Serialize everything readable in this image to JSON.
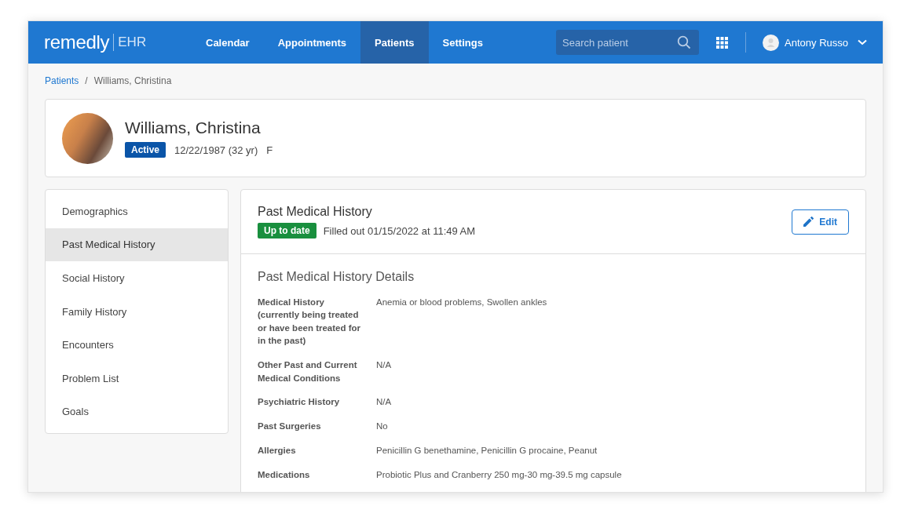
{
  "logo": {
    "name": "remedly",
    "product": "EHR"
  },
  "nav": [
    {
      "label": "Calendar",
      "selected": false
    },
    {
      "label": "Appointments",
      "selected": false
    },
    {
      "label": "Patients",
      "selected": true
    },
    {
      "label": "Settings",
      "selected": false
    }
  ],
  "search": {
    "placeholder": "Search patient"
  },
  "user": {
    "name": "Antony Russo"
  },
  "breadcrumb": {
    "separator": "/",
    "items": [
      {
        "label": "Patients",
        "link": true
      },
      {
        "label": "Williams, Christina",
        "link": false
      }
    ]
  },
  "patient": {
    "name": "Williams, Christina",
    "status": "Active",
    "dob": "12/22/1987 (32 yr)",
    "sex": "F"
  },
  "sidebar": {
    "items": [
      {
        "label": "Demographics",
        "selected": false
      },
      {
        "label": "Past Medical History",
        "selected": true
      },
      {
        "label": "Social History",
        "selected": false
      },
      {
        "label": "Family History",
        "selected": false
      },
      {
        "label": "Encounters",
        "selected": false
      },
      {
        "label": "Problem List",
        "selected": false
      },
      {
        "label": "Goals",
        "selected": false
      }
    ]
  },
  "section": {
    "title": "Past Medical History",
    "status": "Up to date",
    "filled": "Filled out 01/15/2022 at 11:49 AM",
    "edit_button": "Edit",
    "details_title": "Past Medical History Details",
    "details": [
      {
        "label": "Medical History (currently being treated or have been treated for in the past)",
        "value": "Anemia or blood problems, Swollen ankles"
      },
      {
        "label": "Other Past and Current Medical Conditions",
        "value": "N/A"
      },
      {
        "label": "Psychiatric History",
        "value": "N/A"
      },
      {
        "label": "Past Surgeries",
        "value": "No"
      },
      {
        "label": "Allergies",
        "value": "Penicillin G benethamine, Penicillin G procaine, Peanut"
      },
      {
        "label": "Medications",
        "value": "Probiotic Plus and Cranberry 250 mg-30 mg-39.5 mg capsule"
      }
    ]
  }
}
